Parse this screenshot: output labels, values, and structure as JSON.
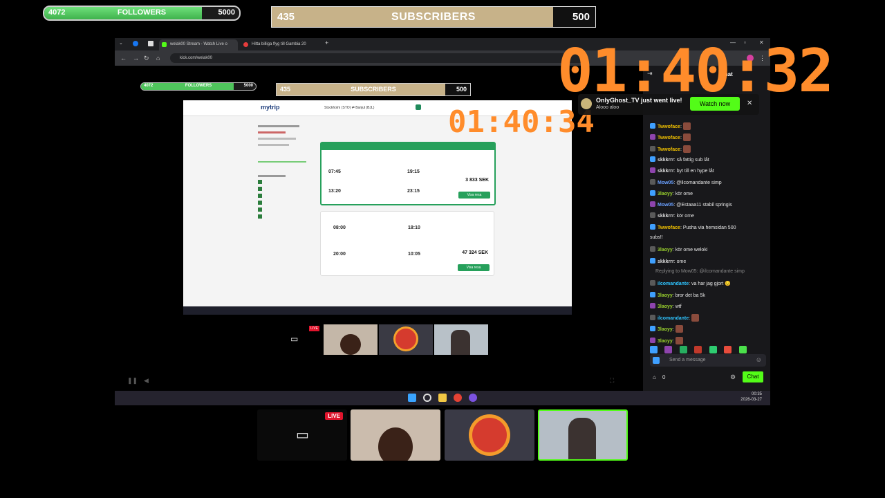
{
  "overlay": {
    "followers": {
      "current": "4072",
      "label": "FOLLOWERS",
      "goal": "5000",
      "progress": 0.81
    },
    "subscribers": {
      "current": "435",
      "label": "SUBSCRIBERS",
      "goal": "500",
      "progress": 0.87
    },
    "timer_big": "01:40:32",
    "timer_inner": "01:40:34"
  },
  "browser": {
    "tabs": [
      {
        "label": "welak00 Stream - Watch Live o",
        "active": true
      },
      {
        "label": "Hitta billiga flyg till Gambia 20",
        "active": false
      }
    ],
    "url": "kick.com/welak00",
    "colors": {
      "kick_green": "#53fc18",
      "mytrip_blue": "#1b3b7a"
    }
  },
  "notification": {
    "title": "OnlyGhost_TV just went live!",
    "subtitle": "Alooo aloo",
    "watch_label": "Watch now",
    "close": "✕"
  },
  "chat": {
    "header": "Chat",
    "messages": [
      {
        "user": "Twwoface",
        "text": "",
        "cls": "u1"
      },
      {
        "user": "Twwoface",
        "text": "",
        "cls": "u1"
      },
      {
        "user": "Twwoface",
        "text": "",
        "cls": "u1"
      },
      {
        "user": "skkkrrr",
        "text": "så fattig sub låt",
        "cls": "u6"
      },
      {
        "user": "skkkrrr",
        "text": "byt till en hype låt",
        "cls": "u6"
      },
      {
        "user": "Mow05",
        "text": "@ilcomandante simp",
        "cls": "u4"
      },
      {
        "user": "3laoyy",
        "text": "kör ome",
        "cls": "u3"
      },
      {
        "user": "Mow05",
        "text": "@Estaaa11 stabil springis",
        "cls": "u4"
      },
      {
        "user": "skkkrrr",
        "text": "kör ome",
        "cls": "u6"
      },
      {
        "user": "Twwoface",
        "text": "Pusha via hemsidan 500",
        "cls": "u1"
      },
      {
        "user": "",
        "text": "subs!!",
        "cls": "u1"
      },
      {
        "user": "3laoyy",
        "text": "kör ome weloki",
        "cls": "u3"
      },
      {
        "user": "skkkrrr",
        "text": "ome",
        "cls": "u6"
      },
      {
        "user": "",
        "text": "Replying to Mow05: @ilcomandante simp",
        "cls": "u6"
      },
      {
        "user": "ilcomandante",
        "text": "va har jag gjort 😔",
        "cls": "u2"
      },
      {
        "user": "3laoyy",
        "text": "bror det ba 5k",
        "cls": "u3"
      },
      {
        "user": "3laoyy",
        "text": "wtf",
        "cls": "u3"
      },
      {
        "user": "ilcomandante",
        "text": "",
        "cls": "u2"
      },
      {
        "user": "3laoyy",
        "text": "",
        "cls": "u3"
      },
      {
        "user": "3laoyy",
        "text": "",
        "cls": "u3"
      }
    ],
    "input_placeholder": "Send a message",
    "count": "0",
    "send_label": "Chat"
  },
  "taskbar": {
    "time": "00:35",
    "date": "2026-03-27"
  },
  "mytrip": {
    "logo": "mytrip",
    "route": "Stockholm (STO) ⇄ Banjul (BJL)",
    "price1": "3 833 SEK",
    "price2": "47 324 SEK",
    "times": [
      "07:45",
      "19:15",
      "13:20",
      "23:15",
      "08:00",
      "18:10",
      "20:00",
      "10:05"
    ],
    "view_label": "Visa resa"
  },
  "cams": {
    "live_label": "LIVE"
  }
}
